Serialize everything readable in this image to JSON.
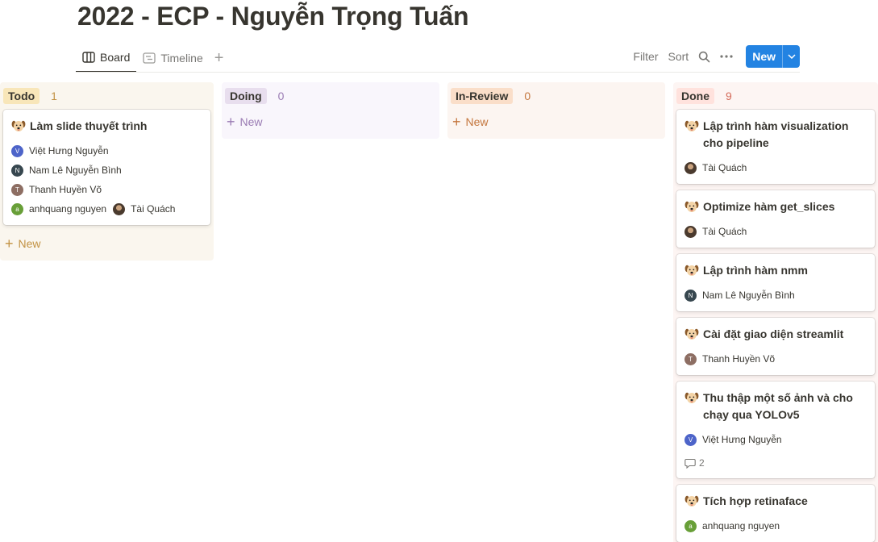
{
  "page": {
    "title": "2022 - ECP - Nguyễn Trọng Tuấn"
  },
  "views": [
    {
      "label": "Board",
      "icon": "board-icon",
      "active": true
    },
    {
      "label": "Timeline",
      "icon": "timeline-icon",
      "active": false
    }
  ],
  "toolbar": {
    "filter": "Filter",
    "sort": "Sort",
    "new": "New"
  },
  "colors": {
    "accent": "#2383e2"
  },
  "columns": [
    {
      "name": "Todo",
      "count": "1",
      "new_label": "New",
      "bg": "#faf6ee",
      "pill_bg": "#f8e6b9",
      "pill_color": "#37352f",
      "count_color": "#c29243",
      "new_color": "#c29243",
      "cards": [
        {
          "icon": "dog-face-icon",
          "title": "Làm slide thuyết trình",
          "people_rows": [
            [
              {
                "name": "Việt Hưng Nguyễn",
                "initial": "V",
                "color": "#4d64c9"
              }
            ],
            [
              {
                "name": "Nam Lê Nguyễn Bình",
                "initial": "N",
                "color": "#37474f"
              }
            ],
            [
              {
                "name": "Thanh Huyền Võ",
                "initial": "T",
                "color": "#8d6e63"
              }
            ],
            [
              {
                "name": "anhquang nguyen",
                "initial": "a",
                "color": "#689f38"
              },
              {
                "name": "Tài Quách",
                "initial": "",
                "color": "#5d4a3a"
              }
            ]
          ]
        }
      ]
    },
    {
      "name": "Doing",
      "count": "0",
      "new_label": "New",
      "bg": "#f9f6fc",
      "pill_bg": "#e8deee",
      "pill_color": "#37352f",
      "count_color": "#9a7bb3",
      "new_color": "#9a7bb3",
      "cards": []
    },
    {
      "name": "In-Review",
      "count": "0",
      "new_label": "New",
      "bg": "#fcf5f1",
      "pill_bg": "#fadec9",
      "pill_color": "#37352f",
      "count_color": "#c4763d",
      "new_color": "#c4763d",
      "cards": []
    },
    {
      "name": "Done",
      "count": "9",
      "new_label": "New",
      "bg": "#fdf5f3",
      "pill_bg": "#ffe2dd",
      "pill_color": "#37352f",
      "count_color": "#d46b5a",
      "new_color": "#d46b5a",
      "cards": [
        {
          "icon": "dog-face-icon",
          "title": "Lập trình hàm visualization cho pipeline",
          "people_rows": [
            [
              {
                "name": "Tài Quách",
                "initial": "",
                "color": "#5d4a3a"
              }
            ]
          ]
        },
        {
          "icon": "dog-face-icon",
          "title": "Optimize hàm get_slices",
          "people_rows": [
            [
              {
                "name": "Tài Quách",
                "initial": "",
                "color": "#5d4a3a"
              }
            ]
          ]
        },
        {
          "icon": "dog-face-icon",
          "title": "Lập trình hàm nmm",
          "people_rows": [
            [
              {
                "name": "Nam Lê Nguyễn Bình",
                "initial": "N",
                "color": "#37474f"
              }
            ]
          ]
        },
        {
          "icon": "dog-face-icon",
          "title": "Cài đặt giao diện streamlit",
          "people_rows": [
            [
              {
                "name": "Thanh Huyền Võ",
                "initial": "T",
                "color": "#8d6e63"
              }
            ]
          ]
        },
        {
          "icon": "dog-face-icon",
          "title": "Thu thập một số ảnh và cho chạy qua YOLOv5",
          "people_rows": [
            [
              {
                "name": "Việt Hưng Nguyễn",
                "initial": "V",
                "color": "#4d64c9"
              }
            ]
          ],
          "comments": "2"
        },
        {
          "icon": "dog-face-icon",
          "title": "Tích hợp retinaface",
          "people_rows": [
            [
              {
                "name": "anhquang nguyen",
                "initial": "a",
                "color": "#689f38"
              }
            ]
          ]
        }
      ]
    }
  ]
}
